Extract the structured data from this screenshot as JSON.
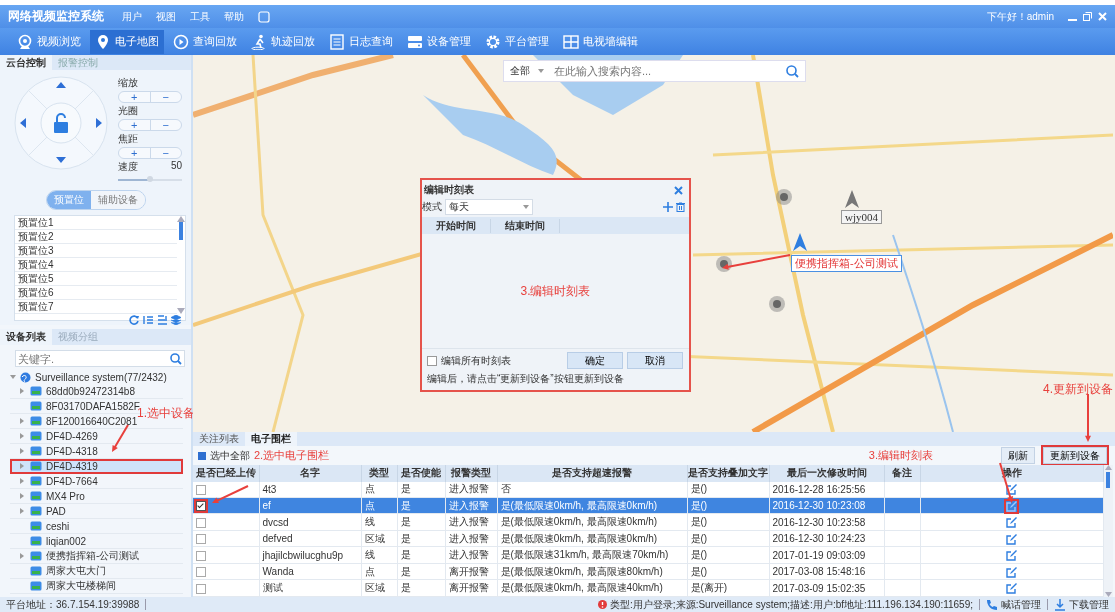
{
  "titlebar": {
    "title": "网络视频监控系统",
    "menu": [
      "用户",
      "视图",
      "工具",
      "帮助"
    ],
    "greeting": "下午好！admin"
  },
  "toolbar": [
    {
      "label": "视频浏览",
      "selected": false
    },
    {
      "label": "电子地图",
      "selected": true
    },
    {
      "label": "查询回放",
      "selected": false
    },
    {
      "label": "轨迹回放",
      "selected": false
    },
    {
      "label": "日志查询",
      "selected": false
    },
    {
      "label": "设备管理",
      "selected": false
    },
    {
      "label": "平台管理",
      "selected": false
    },
    {
      "label": "电视墙编辑",
      "selected": false
    }
  ],
  "ptz": {
    "tabs": [
      {
        "label": "云台控制",
        "selected": true
      },
      {
        "label": "报警控制",
        "selected": false
      }
    ],
    "controls": [
      {
        "label": "缩放",
        "plus": "+",
        "minus": "−"
      },
      {
        "label": "光圈",
        "plus": "+",
        "minus": "−"
      },
      {
        "label": "焦距",
        "plus": "+",
        "minus": "−"
      }
    ],
    "speed": {
      "label": "速度",
      "reading": "50",
      "level": 0.5
    },
    "subtabs": [
      {
        "label": "预置位",
        "selected": true
      },
      {
        "label": "辅助设备",
        "selected": false
      }
    ],
    "presets": [
      "预置位1",
      "预置位2",
      "预置位3",
      "预置位4",
      "预置位5",
      "预置位6",
      "预置位7"
    ]
  },
  "devices": {
    "tabs": [
      {
        "label": "设备列表",
        "selected": true
      },
      {
        "label": "视频分组",
        "selected": false
      }
    ],
    "search": {
      "placeholder": "关键字."
    },
    "annotation": "1.选中设备",
    "tree": {
      "label": "Surveillance system(77/2432)",
      "expanded": true,
      "children": [
        {
          "label": "68dd0b92472314b8",
          "expandable": true,
          "selected": false
        },
        {
          "label": "8F03170DAFA1582F",
          "expandable": false,
          "selected": false
        },
        {
          "label": "8F120016640C2081",
          "expandable": true,
          "selected": false
        },
        {
          "label": "DF4D-4269",
          "expandable": true,
          "selected": false
        },
        {
          "label": "DF4D-4318",
          "expandable": true,
          "selected": false
        },
        {
          "label": "DF4D-4319",
          "expandable": true,
          "selected": true
        },
        {
          "label": "DF4D-7664",
          "expandable": true,
          "selected": false
        },
        {
          "label": "MX4 Pro",
          "expandable": true,
          "selected": false
        },
        {
          "label": "PAD",
          "expandable": true,
          "selected": false
        },
        {
          "label": "ceshi",
          "expandable": false,
          "selected": false
        },
        {
          "label": "liqian002",
          "expandable": false,
          "selected": false
        },
        {
          "label": "便携指挥箱-公司测试",
          "expandable": true,
          "selected": false
        },
        {
          "label": "周家大屯大门",
          "expandable": false,
          "selected": false
        },
        {
          "label": "周家大屯楼梯间",
          "expandable": false,
          "selected": false
        }
      ]
    }
  },
  "map": {
    "search": {
      "scope": "全部",
      "placeholder": "在此输入搜索内容..."
    },
    "markers": [
      {
        "label": "wjy004",
        "highlighted": false
      },
      {
        "label": "便携指挥箱-公司测试",
        "highlighted": true
      }
    ],
    "annotation": "4.更新到设备"
  },
  "dialog": {
    "title": "编辑时刻表",
    "mode_label": "模式",
    "mode": "每天",
    "columns": [
      "开始时间",
      "结束时间"
    ],
    "annotation": "3.编辑时刻表",
    "edit_all": {
      "label": "编辑所有时刻表",
      "checked": false
    },
    "hint": "编辑后，请点击“更新到设备”按钮更新到设备",
    "buttons": [
      "确定",
      "取消"
    ]
  },
  "fence_panel": {
    "tabs": [
      {
        "label": "关注列表",
        "selected": false
      },
      {
        "label": "电子围栏",
        "selected": true
      }
    ],
    "select_all": {
      "label": "选中全部",
      "checked": true
    },
    "select_annotation": "2.选中电子围栏",
    "edit_annotation": "3.编辑时刻表",
    "buttons": [
      {
        "label": "刷新",
        "annotated": false
      },
      {
        "label": "更新到设备",
        "annotated": true
      }
    ],
    "upload_column": "是否已经上传",
    "columns": [
      "名字",
      "类型",
      "是否使能",
      "报警类型",
      "是否支持超速报警",
      "是否支持叠加文字",
      "最后一次修改时间",
      "备注",
      "操作"
    ],
    "rows": [
      {
        "checked": false,
        "selected": false,
        "annotated": false,
        "cells": [
          "4t3",
          "点",
          "是",
          "进入报警",
          "否",
          "是()",
          "2016-12-28 16:25:56"
        ]
      },
      {
        "checked": true,
        "selected": true,
        "annotated": true,
        "cells": [
          "ef",
          "点",
          "是",
          "进入报警",
          "是(最低限速0km/h, 最高限速0km/h)",
          "是()",
          "2016-12-30 10:23:08"
        ]
      },
      {
        "checked": false,
        "selected": false,
        "annotated": false,
        "cells": [
          "dvcsd",
          "线",
          "是",
          "进入报警",
          "是(最低限速0km/h, 最高限速0km/h)",
          "是()",
          "2016-12-30 10:23:58"
        ]
      },
      {
        "checked": false,
        "selected": false,
        "annotated": false,
        "cells": [
          "defved",
          "区域",
          "是",
          "进入报警",
          "是(最低限速0km/h, 最高限速0km/h)",
          "是()",
          "2016-12-30 10:24:23"
        ]
      },
      {
        "checked": false,
        "selected": false,
        "annotated": false,
        "cells": [
          "jhajilcbwilucghu9p",
          "线",
          "是",
          "进入报警",
          "是(最低限速31km/h, 最高限速70km/h)",
          "是()",
          "2017-01-19 09:03:09"
        ]
      },
      {
        "checked": false,
        "selected": false,
        "annotated": false,
        "cells": [
          "Wanda",
          "点",
          "是",
          "离开报警",
          "是(最低限速0km/h, 最高限速80km/h)",
          "是()",
          "2017-03-08 15:48:16"
        ]
      },
      {
        "checked": false,
        "selected": false,
        "annotated": false,
        "cells": [
          "测试",
          "区域",
          "是",
          "离开报警",
          "是(最低限速0km/h, 最高限速40km/h)",
          "是(离开)",
          "2017-03-09 15:02:35"
        ]
      }
    ]
  },
  "status_bar": {
    "address": "平台地址：36.7.154.19:39988",
    "message": "类型:用户登录;来源:Surveillance system;描述:用户:bf地址:111.196.134.190:11659;",
    "links": [
      "喊话管理",
      "下载管理"
    ]
  }
}
